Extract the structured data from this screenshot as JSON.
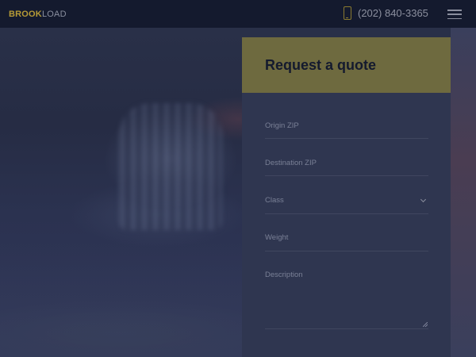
{
  "navbar": {
    "logo_part1": "BROOK",
    "logo_part2": "LOAD",
    "phone": "(202) 840-3365",
    "phone_icon": "smartphone-icon",
    "menu_icon": "hamburger-menu-icon"
  },
  "quote_form": {
    "title": "Request a quote",
    "fields": {
      "origin_zip": {
        "placeholder": "Origin ZIP",
        "value": ""
      },
      "destination_zip": {
        "placeholder": "Destination ZIP",
        "value": ""
      },
      "class": {
        "selected": "Class"
      },
      "weight": {
        "placeholder": "Weight",
        "value": ""
      },
      "description": {
        "placeholder": "Description",
        "value": ""
      }
    }
  },
  "colors": {
    "accent": "#b59a36",
    "navbar_bg": "#141a2e",
    "card_header_bg": "#6e6a3f",
    "card_bg": "#2f3650"
  }
}
